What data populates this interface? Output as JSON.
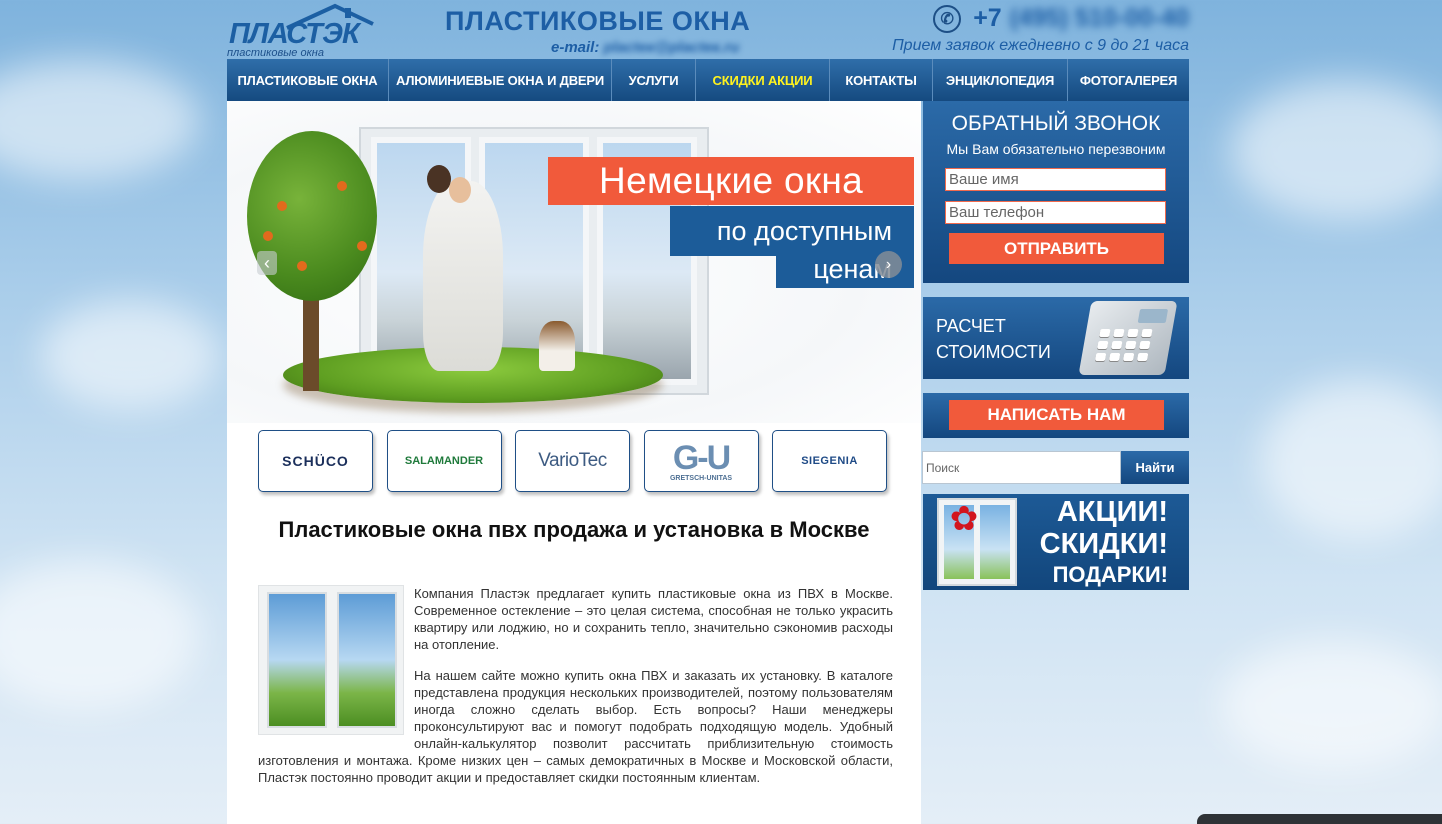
{
  "header": {
    "logo_text": "ПЛАСТЭК",
    "logo_subtitle": "пластиковые окна",
    "site_title": "ПЛАСТИКОВЫЕ ОКНА",
    "email_label": "e-mail:",
    "email_value": "placteк@placteк.ru",
    "phone_prefix": "+7",
    "phone_number": "(495) 510-00-40",
    "hours": "Прием заявок ежедневно с 9 до 21 часа"
  },
  "nav": {
    "items": [
      {
        "label": "ПЛАСТИКОВЫЕ ОКНА"
      },
      {
        "label": "АЛЮМИНИЕВЫЕ ОКНА И ДВЕРИ"
      },
      {
        "label": "УСЛУГИ"
      },
      {
        "label": "СКИДКИ АКЦИИ"
      },
      {
        "label": "КОНТАКТЫ"
      },
      {
        "label": "ЭНЦИКЛОПЕДИЯ"
      },
      {
        "label": "ФОТОГАЛЕРЕЯ"
      }
    ],
    "active_index": 3
  },
  "banner": {
    "slogan_line1": "Немецкие окна",
    "slogan_line2": "по доступным",
    "slogan_line3": "ценам"
  },
  "brands": [
    {
      "name": "SCHÜCO"
    },
    {
      "name": "SALAMANDER"
    },
    {
      "name": "VarioTec"
    },
    {
      "name": "G-U",
      "sub": "GRETSCH-UNITAS"
    },
    {
      "name": "SIEGENIA"
    }
  ],
  "content": {
    "heading": "Пластиковые окна пвх продажа и установка в Москве",
    "paragraph1": "Компания Пластэк предлагает купить пластиковые окна из ПВХ в Москве. Современное остекление – это целая система, способная не только украсить квартиру или лоджию, но и сохранить тепло, значительно сэкономив расходы на отопление.",
    "paragraph2": "На нашем сайте можно купить окна ПВХ и заказать их установку. В каталоге представлена продукция нескольких производителей, поэтому пользователям иногда сложно сделать выбор. Есть вопросы? Наши менеджеры проконсультируют вас и помогут подобрать подходящую модель. Удобный онлайн-калькулятор позволит рассчитать приблизительную стоимость изготовления и монтажа. Кроме низких цен – самых демократичных в Москве и Московской области, Пластэк постоянно проводит акции и предоставляет скидки постоянным клиентам."
  },
  "callback": {
    "title": "ОБРАТНЫЙ ЗВОНОК",
    "subtitle": "Мы Вам обязательно перезвоним",
    "name_placeholder": "Ваше имя",
    "phone_placeholder": "Ваш телефон",
    "submit_label": "ОТПРАВИТЬ"
  },
  "calculator": {
    "line1": "РАСЧЕТ",
    "line2": "СТОИМОСТИ"
  },
  "write_us": {
    "label": "НАПИСАТЬ НАМ"
  },
  "search": {
    "placeholder": "Поиск",
    "button_label": "Найти"
  },
  "promo": {
    "line1": "АКЦИИ!",
    "line2": "СКИДКИ!",
    "line3": "ПОДАРКИ!"
  },
  "colors": {
    "primary_blue": "#1d5ea5",
    "nav_blue": "#154a80",
    "accent_orange": "#f15a3b",
    "active_nav": "#fff21e"
  }
}
